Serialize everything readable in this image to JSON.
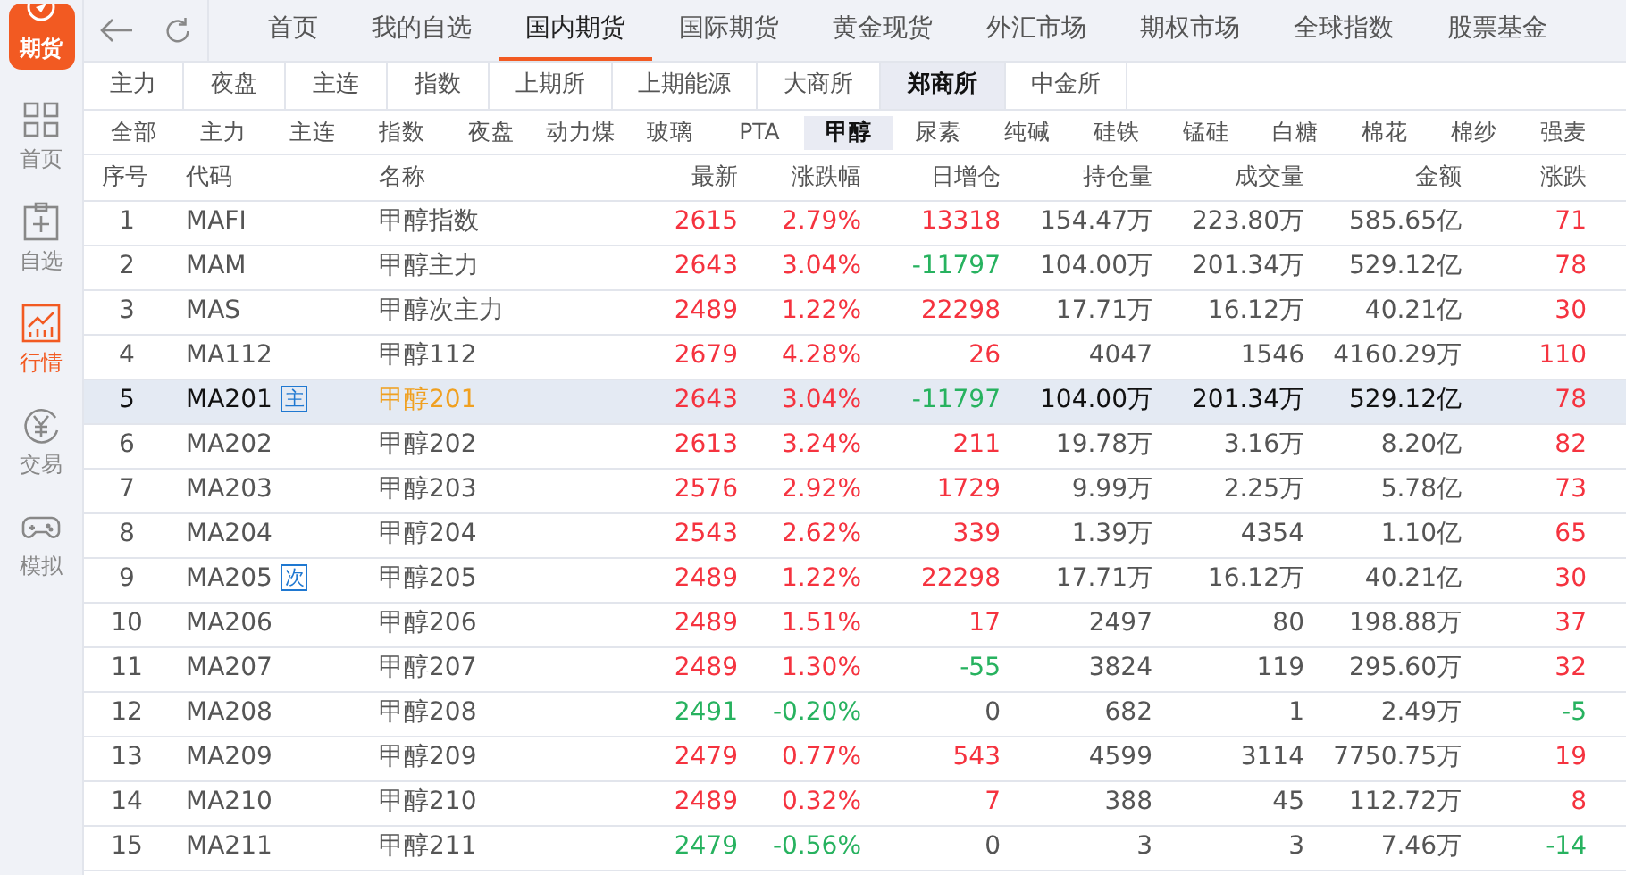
{
  "app_logo": {
    "label": "期货"
  },
  "sidebar": [
    {
      "label": "首页",
      "kind": "grid",
      "selected": false
    },
    {
      "label": "自选",
      "kind": "clipboard",
      "selected": false
    },
    {
      "label": "行情",
      "kind": "chart",
      "selected": true
    },
    {
      "label": "交易",
      "kind": "yen",
      "selected": false
    },
    {
      "label": "模拟",
      "kind": "gamepad",
      "selected": false
    }
  ],
  "top_tabs": [
    {
      "label": "首页",
      "selected": false
    },
    {
      "label": "我的自选",
      "selected": false
    },
    {
      "label": "国内期货",
      "selected": true
    },
    {
      "label": "国际期货",
      "selected": false
    },
    {
      "label": "黄金现货",
      "selected": false
    },
    {
      "label": "外汇市场",
      "selected": false
    },
    {
      "label": "期权市场",
      "selected": false
    },
    {
      "label": "全球指数",
      "selected": false
    },
    {
      "label": "股票基金",
      "selected": false
    }
  ],
  "exchange_tabs": [
    {
      "label": "主力",
      "selected": false
    },
    {
      "label": "夜盘",
      "selected": false
    },
    {
      "label": "主连",
      "selected": false
    },
    {
      "label": "指数",
      "selected": false
    },
    {
      "label": "上期所",
      "selected": false
    },
    {
      "label": "上期能源",
      "selected": false
    },
    {
      "label": "大商所",
      "selected": false
    },
    {
      "label": "郑商所",
      "selected": true
    },
    {
      "label": "中金所",
      "selected": false
    }
  ],
  "product_tabs": [
    {
      "label": "全部",
      "selected": false
    },
    {
      "label": "主力",
      "selected": false
    },
    {
      "label": "主连",
      "selected": false
    },
    {
      "label": "指数",
      "selected": false
    },
    {
      "label": "夜盘",
      "selected": false
    },
    {
      "label": "动力煤",
      "selected": false
    },
    {
      "label": "玻璃",
      "selected": false
    },
    {
      "label": "PTA",
      "selected": false
    },
    {
      "label": "甲醇",
      "selected": true
    },
    {
      "label": "尿素",
      "selected": false
    },
    {
      "label": "纯碱",
      "selected": false
    },
    {
      "label": "硅铁",
      "selected": false
    },
    {
      "label": "锰硅",
      "selected": false
    },
    {
      "label": "白糖",
      "selected": false
    },
    {
      "label": "棉花",
      "selected": false
    },
    {
      "label": "棉纱",
      "selected": false
    },
    {
      "label": "强麦",
      "selected": false
    }
  ],
  "table": {
    "columns": [
      "序号",
      "代码",
      "名称",
      "最新",
      "涨跌幅",
      "日增仓",
      "持仓量",
      "成交量",
      "金额",
      "涨跌"
    ],
    "rows": [
      {
        "no": "1",
        "code": "MAFI",
        "name": "甲醇指数",
        "last": "2615",
        "pct": "2.79%",
        "oi_change": {
          "text": "13318",
          "color": "#f5333f"
        },
        "oi": "154.47万",
        "volume": "223.80万",
        "amount": "585.65亿",
        "change": "71",
        "color": "#f5333f",
        "selected": false
      },
      {
        "no": "2",
        "code": "MAM",
        "name": "甲醇主力",
        "last": "2643",
        "pct": "3.04%",
        "oi_change": {
          "text": "-11797",
          "color": "#27b25f"
        },
        "oi": "104.00万",
        "volume": "201.34万",
        "amount": "529.12亿",
        "change": "78",
        "color": "#f5333f",
        "selected": false
      },
      {
        "no": "3",
        "code": "MAS",
        "name": "甲醇次主力",
        "last": "2489",
        "pct": "1.22%",
        "oi_change": {
          "text": "22298",
          "color": "#f5333f"
        },
        "oi": "17.71万",
        "volume": "16.12万",
        "amount": "40.21亿",
        "change": "30",
        "color": "#f5333f",
        "selected": false
      },
      {
        "no": "4",
        "code": "MA112",
        "name": "甲醇112",
        "last": "2679",
        "pct": "4.28%",
        "oi_change": {
          "text": "26",
          "color": "#f5333f"
        },
        "oi": "4047",
        "volume": "1546",
        "amount": "4160.29万",
        "change": "110",
        "color": "#f5333f",
        "selected": false
      },
      {
        "no": "5",
        "code": "MA201",
        "tag": "主",
        "name": "甲醇201",
        "last": "2643",
        "pct": "3.04%",
        "oi_change": {
          "text": "-11797",
          "color": "#27b25f"
        },
        "oi": "104.00万",
        "volume": "201.34万",
        "amount": "529.12亿",
        "change": "78",
        "color": "#f5333f",
        "selected": true
      },
      {
        "no": "6",
        "code": "MA202",
        "name": "甲醇202",
        "last": "2613",
        "pct": "3.24%",
        "oi_change": {
          "text": "211",
          "color": "#f5333f"
        },
        "oi": "19.78万",
        "volume": "3.16万",
        "amount": "8.20亿",
        "change": "82",
        "color": "#f5333f",
        "selected": false
      },
      {
        "no": "7",
        "code": "MA203",
        "name": "甲醇203",
        "last": "2576",
        "pct": "2.92%",
        "oi_change": {
          "text": "1729",
          "color": "#f5333f"
        },
        "oi": "9.99万",
        "volume": "2.25万",
        "amount": "5.78亿",
        "change": "73",
        "color": "#f5333f",
        "selected": false
      },
      {
        "no": "8",
        "code": "MA204",
        "name": "甲醇204",
        "last": "2543",
        "pct": "2.62%",
        "oi_change": {
          "text": "339",
          "color": "#f5333f"
        },
        "oi": "1.39万",
        "volume": "4354",
        "amount": "1.10亿",
        "change": "65",
        "color": "#f5333f",
        "selected": false
      },
      {
        "no": "9",
        "code": "MA205",
        "tag": "次",
        "name": "甲醇205",
        "last": "2489",
        "pct": "1.22%",
        "oi_change": {
          "text": "22298",
          "color": "#f5333f"
        },
        "oi": "17.71万",
        "volume": "16.12万",
        "amount": "40.21亿",
        "change": "30",
        "color": "#f5333f",
        "selected": false
      },
      {
        "no": "10",
        "code": "MA206",
        "name": "甲醇206",
        "last": "2489",
        "pct": "1.51%",
        "oi_change": {
          "text": "17",
          "color": "#f5333f"
        },
        "oi": "2497",
        "volume": "80",
        "amount": "198.88万",
        "change": "37",
        "color": "#f5333f",
        "selected": false
      },
      {
        "no": "11",
        "code": "MA207",
        "name": "甲醇207",
        "last": "2489",
        "pct": "1.30%",
        "oi_change": {
          "text": "-55",
          "color": "#27b25f"
        },
        "oi": "3824",
        "volume": "119",
        "amount": "295.60万",
        "change": "32",
        "color": "#f5333f",
        "selected": false
      },
      {
        "no": "12",
        "code": "MA208",
        "name": "甲醇208",
        "last": "2491",
        "pct": "-0.20%",
        "oi_change": {
          "text": "0",
          "color": "#555555"
        },
        "oi": "682",
        "volume": "1",
        "amount": "2.49万",
        "change": "-5",
        "color": "#27b25f",
        "selected": false
      },
      {
        "no": "13",
        "code": "MA209",
        "name": "甲醇209",
        "last": "2479",
        "pct": "0.77%",
        "oi_change": {
          "text": "543",
          "color": "#f5333f"
        },
        "oi": "4599",
        "volume": "3114",
        "amount": "7750.75万",
        "change": "19",
        "color": "#f5333f",
        "selected": false
      },
      {
        "no": "14",
        "code": "MA210",
        "name": "甲醇210",
        "last": "2489",
        "pct": "0.32%",
        "oi_change": {
          "text": "7",
          "color": "#f5333f"
        },
        "oi": "388",
        "volume": "45",
        "amount": "112.72万",
        "change": "8",
        "color": "#f5333f",
        "selected": false
      },
      {
        "no": "15",
        "code": "MA211",
        "name": "甲醇211",
        "last": "2479",
        "pct": "-0.56%",
        "oi_change": {
          "text": "0",
          "color": "#555555"
        },
        "oi": "3",
        "volume": "3",
        "amount": "7.46万",
        "change": "-14",
        "color": "#27b25f",
        "selected": false
      }
    ]
  }
}
